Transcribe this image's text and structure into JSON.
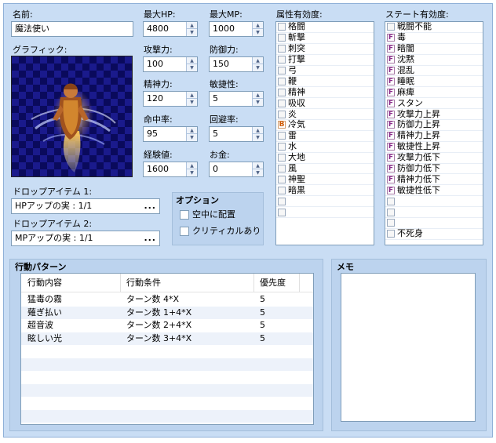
{
  "labels": {
    "name": "名前:",
    "max_hp": "最大HP:",
    "max_mp": "最大MP:",
    "graphic": "グラフィック:",
    "attack": "攻撃力:",
    "defense": "防御力:",
    "spirit": "精神力:",
    "agility": "敏捷性:",
    "hit": "命中率:",
    "evasion": "回避率:",
    "exp": "経験値:",
    "gold": "お金:",
    "drop1": "ドロップアイテム 1:",
    "drop2": "ドロップアイテム 2:",
    "element_title": "属性有効度:",
    "state_title": "ステート有効度:",
    "options_title": "オプション",
    "option_levitate": "空中に配置",
    "option_critical": "クリティカルあり",
    "actions_title": "行動パターン",
    "memo_title": "メモ",
    "col_action": "行動内容",
    "col_condition": "行動条件",
    "col_priority": "優先度"
  },
  "values": {
    "name": "魔法使い",
    "max_hp": "4800",
    "max_mp": "1000",
    "attack": "100",
    "defense": "150",
    "spirit": "120",
    "agility": "5",
    "hit": "95",
    "evasion": "5",
    "exp": "1600",
    "gold": "0",
    "drop1": "HPアップの実 : 1/1",
    "drop2": "MPアップの実 : 1/1",
    "memo": ""
  },
  "ellipsis": "...",
  "elements": [
    {
      "mark": "",
      "name": "格闘"
    },
    {
      "mark": "",
      "name": "斬撃"
    },
    {
      "mark": "",
      "name": "刺突"
    },
    {
      "mark": "",
      "name": "打撃"
    },
    {
      "mark": "",
      "name": "弓"
    },
    {
      "mark": "",
      "name": "鞭"
    },
    {
      "mark": "",
      "name": "精神"
    },
    {
      "mark": "",
      "name": "吸収"
    },
    {
      "mark": "",
      "name": "炎"
    },
    {
      "mark": "B",
      "name": "冷気"
    },
    {
      "mark": "",
      "name": "雷"
    },
    {
      "mark": "",
      "name": "水"
    },
    {
      "mark": "",
      "name": "大地"
    },
    {
      "mark": "",
      "name": "風"
    },
    {
      "mark": "",
      "name": "神聖"
    },
    {
      "mark": "",
      "name": "暗黒"
    },
    {
      "mark": "",
      "name": ""
    },
    {
      "mark": "",
      "name": ""
    }
  ],
  "states": [
    {
      "mark": "",
      "name": "戦闘不能"
    },
    {
      "mark": "F",
      "name": "毒"
    },
    {
      "mark": "F",
      "name": "暗闇"
    },
    {
      "mark": "F",
      "name": "沈黙"
    },
    {
      "mark": "F",
      "name": "混乱"
    },
    {
      "mark": "F",
      "name": "睡眠"
    },
    {
      "mark": "F",
      "name": "麻痺"
    },
    {
      "mark": "F",
      "name": "スタン"
    },
    {
      "mark": "F",
      "name": "攻撃力上昇"
    },
    {
      "mark": "F",
      "name": "防御力上昇"
    },
    {
      "mark": "F",
      "name": "精神力上昇"
    },
    {
      "mark": "F",
      "name": "敏捷性上昇"
    },
    {
      "mark": "F",
      "name": "攻撃力低下"
    },
    {
      "mark": "F",
      "name": "防御力低下"
    },
    {
      "mark": "F",
      "name": "精神力低下"
    },
    {
      "mark": "F",
      "name": "敏捷性低下"
    },
    {
      "mark": "",
      "name": ""
    },
    {
      "mark": "",
      "name": ""
    },
    {
      "mark": "",
      "name": ""
    },
    {
      "mark": "",
      "name": "不死身"
    }
  ],
  "actions": [
    {
      "action": "猛毒の霧",
      "condition": "ターン数 4*X",
      "priority": "5"
    },
    {
      "action": "薙ぎ払い",
      "condition": "ターン数 1+4*X",
      "priority": "5"
    },
    {
      "action": "超音波",
      "condition": "ターン数 2+4*X",
      "priority": "5"
    },
    {
      "action": "眩しい光",
      "condition": "ターン数 3+4*X",
      "priority": "5"
    }
  ],
  "options": {
    "levitate": false,
    "critical": false
  }
}
